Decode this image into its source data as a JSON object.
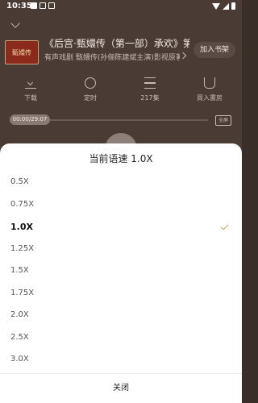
{
  "status_bar": {
    "time": "10:35"
  },
  "player": {
    "book_title": "《后宫·甄嬛传（第一部）承欢》第",
    "book_subtitle": "有声戏剧 甄嬛传(孙俪陈建斌主演)影视原著...",
    "cover_text": "甄嬛传",
    "add_shelf_label": "加入书架",
    "actions": [
      {
        "label": "下载",
        "icon": "download-icon"
      },
      {
        "label": "定时",
        "icon": "timer-icon"
      },
      {
        "label": "217集",
        "icon": "list-icon"
      },
      {
        "label": "買入書房",
        "icon": "cup-icon"
      }
    ],
    "progress_time": "00:00/29:07",
    "fullscreen_label": "全屏"
  },
  "speed_sheet": {
    "title": "当前语速 1.0X",
    "options": [
      "0.5X",
      "0.75X",
      "1.0X",
      "1.25X",
      "1.5X",
      "1.75X",
      "2.0X",
      "2.5X",
      "3.0X"
    ],
    "selected": "1.0X",
    "close_label": "关闭",
    "accent_color": "#c9a867"
  }
}
